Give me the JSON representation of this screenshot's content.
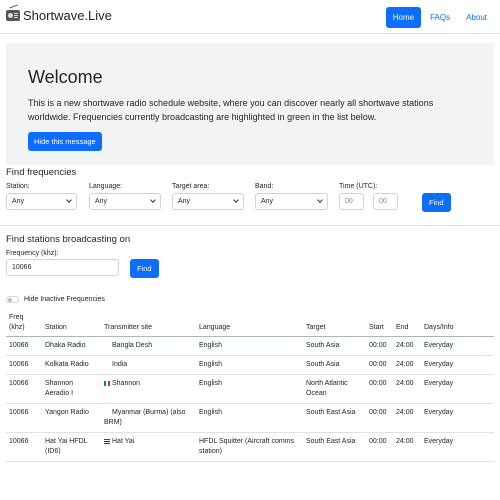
{
  "navbar": {
    "brand": "Shortwave.Live",
    "links": [
      "Home",
      "FAQs",
      "About"
    ]
  },
  "welcome": {
    "title": "Welcome",
    "text": "This is a new shortwave radio schedule website, where you can discover nearly all shortwave stations worldwide. Frequencies currently broadcasting are highlighted in green in the list below.",
    "hide_button": "Hide this message"
  },
  "find_frequencies": {
    "title": "Find frequencies",
    "station_label": "Station:",
    "station_value": "Any",
    "language_label": "Language:",
    "language_value": "Any",
    "target_label": "Target area:",
    "target_value": "Any",
    "band_label": "Band:",
    "band_value": "Any",
    "time_label": "Time (UTC):",
    "time_start_placeholder": "00",
    "time_end_placeholder": "00",
    "find_button": "Find"
  },
  "find_stations": {
    "title": "Find stations broadcasting on",
    "freq_label": "Frequency (khz):",
    "freq_value": "10066",
    "find_button": "Find"
  },
  "toggle": {
    "label": "Hide Inactive Frequencies"
  },
  "table": {
    "headers": [
      "Freq (khz)",
      "Station",
      "Transmitter site",
      "Language",
      "Target",
      "Start",
      "End",
      "Days/Info"
    ],
    "rows": [
      {
        "freq": "10066",
        "station": "Dhaka Radio",
        "flag": "",
        "site": "Bangla Desh",
        "language": "English",
        "target": "South Asia",
        "start": "00:00",
        "end": "24:00",
        "days": "Everyday"
      },
      {
        "freq": "10066",
        "station": "Kolkata Radio",
        "flag": "",
        "site": "India",
        "language": "English",
        "target": "South Asia",
        "start": "00:00",
        "end": "24:00",
        "days": "Everyday"
      },
      {
        "freq": "10066",
        "station": "Shannon Aeradio I",
        "flag": "italy-flag",
        "site": "Shannon",
        "language": "English",
        "target": "North Atlantic Ocean",
        "start": "00:00",
        "end": "24:00",
        "days": "Everyday"
      },
      {
        "freq": "10066",
        "station": "Yangon Radio",
        "flag": "",
        "site": "Myanmar (Burma) (also BRM)",
        "language": "English",
        "target": "South East Asia",
        "start": "00:00",
        "end": "24:00",
        "days": "Everyday"
      },
      {
        "freq": "10066",
        "station": "Hat Yai HFDL (ID6)",
        "flag": "thailand-flag",
        "site": "Hat Yai",
        "language": "HFDL Squitter (Aircraft comms station)",
        "target": "South East Asia",
        "start": "00:00",
        "end": "24:00",
        "days": "Everyday"
      }
    ]
  }
}
